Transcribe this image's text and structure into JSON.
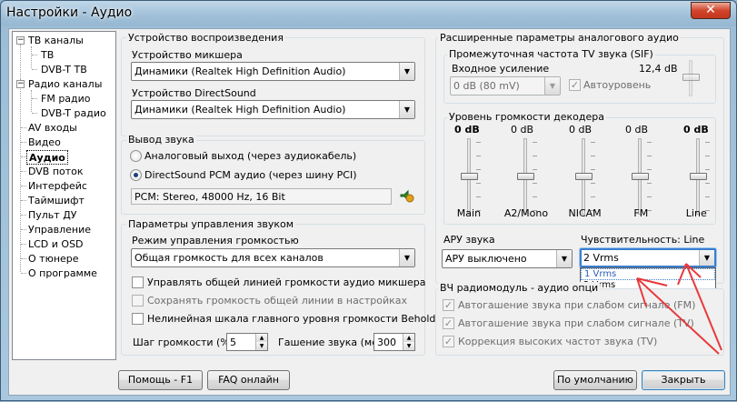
{
  "window": {
    "title": "Настройки - Аудио",
    "close_glyph": "✕"
  },
  "tree": {
    "nodes": [
      {
        "label": "ТВ каналы"
      },
      {
        "label": "ТВ"
      },
      {
        "label": "DVB-T ТВ"
      },
      {
        "label": "Радио каналы"
      },
      {
        "label": "FM радио"
      },
      {
        "label": "DVB-T радио"
      },
      {
        "label": "AV входы"
      },
      {
        "label": "Видео"
      },
      {
        "label": "Аудио"
      },
      {
        "label": "DVB поток"
      },
      {
        "label": "Интерфейс"
      },
      {
        "label": "Таймшифт"
      },
      {
        "label": "Пульт ДУ"
      },
      {
        "label": "Управление"
      },
      {
        "label": "LCD и OSD"
      },
      {
        "label": "О тюнере"
      },
      {
        "label": "О программе"
      }
    ],
    "expand_glyph": "−"
  },
  "playback": {
    "title": "Устройство воспроизведения",
    "mixer_label": "Устройство микшера",
    "mixer_value": "Динамики (Realtek High Definition Audio)",
    "ds_label": "Устройство DirectSound",
    "ds_value": "Динамики (Realtek High Definition Audio)"
  },
  "output": {
    "title": "Вывод звука",
    "analog_label": "Аналоговый выход (через аудиокабель)",
    "ds_label": "DirectSound PCM аудио (через шину PCI)",
    "format_value": "PCM: Stereo, 48000 Hz, 16 Bit"
  },
  "volume_ctrl": {
    "title": "Параметры управления звуком",
    "mode_label": "Режим управления громкостью",
    "mode_value": "Общая громкость для всех каналов",
    "chk1": "Управлять общей линией громкости аудио микшера",
    "chk2": "Сохранять громкость общей линии в настройках",
    "chk3": "Нелинейная шкала главного уровня громкости Behold TV",
    "step_label": "Шаг громкости (%)",
    "step_value": "5",
    "fade_label": "Гашение звука (мс)",
    "fade_value": "300"
  },
  "advanced": {
    "title": "Расширенные параметры аналогового аудио",
    "sif_title": "Промежуточная частота TV звука (SIF)",
    "gain_label": "Входное усиление",
    "gain_db": "12,4 dB",
    "gain_value": "0 dB (80 mV)",
    "auto_label": "Автоуровень",
    "decoder_title": "Уровень громкости декодера",
    "channels": [
      {
        "label": "Main",
        "db": "0 dB",
        "level": 0.5,
        "bold": true
      },
      {
        "label": "A2/Mono",
        "db": "0 dB",
        "level": 0.5,
        "bold": false
      },
      {
        "label": "NICAM",
        "db": "0 dB",
        "level": 0.5,
        "bold": false
      },
      {
        "label": "FM",
        "db": "0 dB",
        "level": 0.5,
        "bold": false
      },
      {
        "label": "Line",
        "db": "0 dB",
        "level": 0.5,
        "bold": true
      }
    ],
    "agc_label": "АРУ звука",
    "agc_value": "АРУ выключено",
    "sens_label": "Чувствительность: Line",
    "sens_value": "2 Vrms",
    "sens_options": [
      "1 Vrms",
      "2 Vrms"
    ]
  },
  "rf": {
    "title": "ВЧ радиомодуль - аудио опци",
    "chk1": "Автогашение звука при слабом сигнале (FM)",
    "chk2": "Автогашение звука при слабом сигнале (TV)",
    "chk3": "Коррекция высоких частот звука (TV)"
  },
  "buttons": {
    "help": "Помощь - F1",
    "faq": "FAQ онлайн",
    "defaults": "По умолчанию",
    "close": "Закрыть"
  },
  "colors": {
    "annotation_arrow": "#e8393b",
    "focus": "#3a7ed0"
  }
}
